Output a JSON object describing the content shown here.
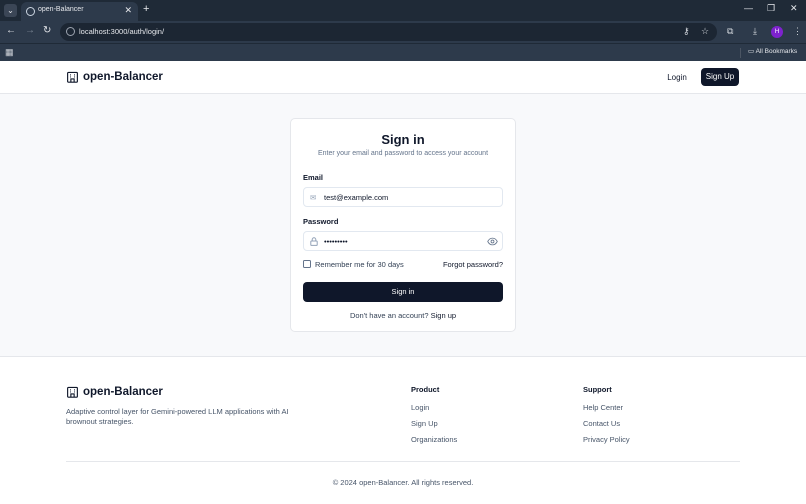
{
  "browser": {
    "tab_title": "open-Balancer",
    "url": "localhost:3000/auth/login/",
    "profile_initial": "H",
    "bookmarks_label": "All Bookmarks"
  },
  "header": {
    "brand": "open-Balancer",
    "login_label": "Login",
    "signup_label": "Sign Up"
  },
  "signin": {
    "title": "Sign in",
    "subtitle": "Enter your email and password to access your account",
    "email_label": "Email",
    "email_value": "test@example.com",
    "password_label": "Password",
    "password_value": "•••••••••",
    "remember_label": "Remember me for 30 days",
    "remember_checked": false,
    "forgot_label": "Forgot password?",
    "submit_label": "Sign in",
    "no_account_text": "Don't have an account?",
    "signup_link": "Sign up"
  },
  "footer": {
    "brand": "open-Balancer",
    "description": "Adaptive control layer for Gemini-powered LLM applications with AI brownout strategies.",
    "product_heading": "Product",
    "product_links": [
      "Login",
      "Sign Up",
      "Organizations"
    ],
    "support_heading": "Support",
    "support_links": [
      "Help Center",
      "Contact Us",
      "Privacy Policy"
    ],
    "copyright": "© 2024 open-Balancer. All rights reserved."
  },
  "colors": {
    "primary": "#0f172a",
    "muted": "#64748b",
    "border": "#e5e7eb",
    "page_bg": "#f8f9fb",
    "chrome_bg": "#2d3a4b"
  }
}
